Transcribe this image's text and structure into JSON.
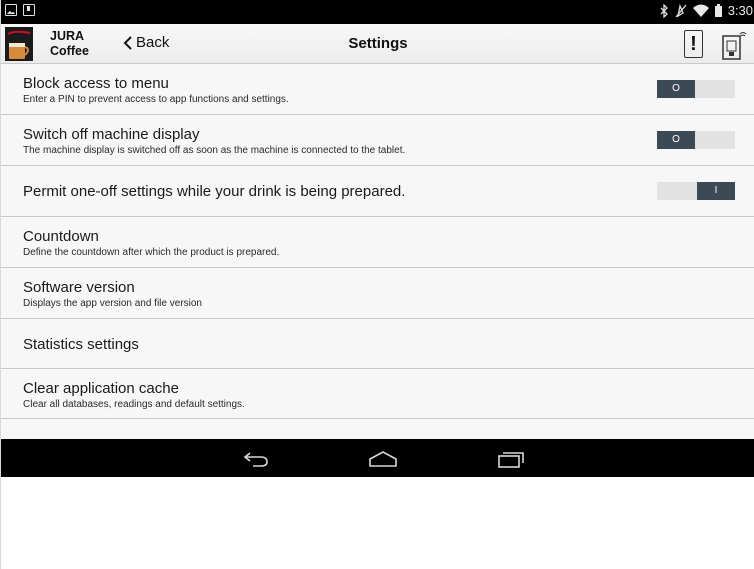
{
  "status_bar": {
    "time": "3:30",
    "left_icons": [
      "image-notification-icon",
      "download-notification-icon"
    ],
    "right_icons": [
      "bluetooth-icon",
      "mute-icon",
      "wifi-icon",
      "battery-icon"
    ]
  },
  "header": {
    "brand_line1": "JURA",
    "brand_line2": "Coffee",
    "back_label": "Back",
    "title": "Settings"
  },
  "settings": [
    {
      "title": "Block access to menu",
      "subtitle": "Enter a PIN to prevent access to app functions and settings.",
      "toggle": "O",
      "toggle_state": "off"
    },
    {
      "title": "Switch off machine display",
      "subtitle": "The machine display is switched off as soon as the machine is connected to the tablet.",
      "toggle": "O",
      "toggle_state": "off"
    },
    {
      "title": "Permit one-off settings while your drink is being prepared.",
      "toggle": "I",
      "toggle_state": "on"
    },
    {
      "title": "Countdown",
      "subtitle": "Define the countdown after which the product is prepared."
    },
    {
      "title": "Software version",
      "subtitle": "Displays the app version and file version"
    },
    {
      "title": "Statistics settings"
    },
    {
      "title": "Clear application cache",
      "subtitle": "Clear all databases, readings and default settings."
    }
  ],
  "nav": [
    "back-nav-icon",
    "home-nav-icon",
    "recent-apps-icon"
  ],
  "colors": {
    "toggle_knob": "#3c4a56",
    "toggle_track": "#e2e2e2",
    "list_background": "#f7f7f7",
    "brand_red": "#c8102e"
  }
}
